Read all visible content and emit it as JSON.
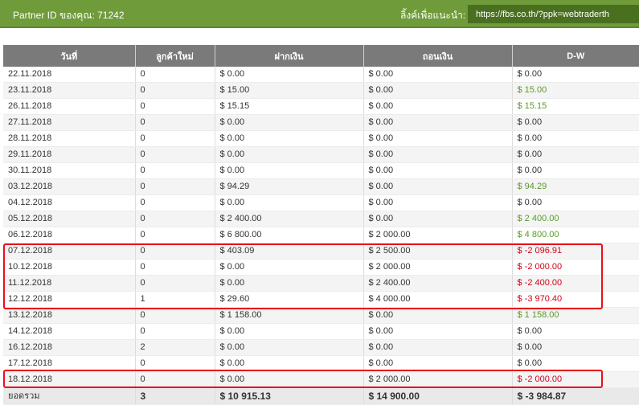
{
  "header": {
    "partner_label": "Partner ID ของคุณ: 71242",
    "referral_label": "ลิ้งค์เพื่อแนะนำ:",
    "referral_link": "https://fbs.co.th/?ppk=webtraderth"
  },
  "table": {
    "columns": [
      "วันที่",
      "ลูกค้าใหม่",
      "ฝากเงิน",
      "ถอนเงิน",
      "D-W"
    ],
    "rows": [
      {
        "date": "22.11.2018",
        "new": "0",
        "deposit": "$ 0.00",
        "withdraw": "$ 0.00",
        "dw": "$ 0.00",
        "dw_type": "zero"
      },
      {
        "date": "23.11.2018",
        "new": "0",
        "deposit": "$ 15.00",
        "withdraw": "$ 0.00",
        "dw": "$ 15.00",
        "dw_type": "pos"
      },
      {
        "date": "26.11.2018",
        "new": "0",
        "deposit": "$ 15.15",
        "withdraw": "$ 0.00",
        "dw": "$ 15.15",
        "dw_type": "pos"
      },
      {
        "date": "27.11.2018",
        "new": "0",
        "deposit": "$ 0.00",
        "withdraw": "$ 0.00",
        "dw": "$ 0.00",
        "dw_type": "zero"
      },
      {
        "date": "28.11.2018",
        "new": "0",
        "deposit": "$ 0.00",
        "withdraw": "$ 0.00",
        "dw": "$ 0.00",
        "dw_type": "zero"
      },
      {
        "date": "29.11.2018",
        "new": "0",
        "deposit": "$ 0.00",
        "withdraw": "$ 0.00",
        "dw": "$ 0.00",
        "dw_type": "zero"
      },
      {
        "date": "30.11.2018",
        "new": "0",
        "deposit": "$ 0.00",
        "withdraw": "$ 0.00",
        "dw": "$ 0.00",
        "dw_type": "zero"
      },
      {
        "date": "03.12.2018",
        "new": "0",
        "deposit": "$ 94.29",
        "withdraw": "$ 0.00",
        "dw": "$ 94.29",
        "dw_type": "pos"
      },
      {
        "date": "04.12.2018",
        "new": "0",
        "deposit": "$ 0.00",
        "withdraw": "$ 0.00",
        "dw": "$ 0.00",
        "dw_type": "zero"
      },
      {
        "date": "05.12.2018",
        "new": "0",
        "deposit": "$ 2 400.00",
        "withdraw": "$ 0.00",
        "dw": "$ 2 400.00",
        "dw_type": "pos"
      },
      {
        "date": "06.12.2018",
        "new": "0",
        "deposit": "$ 6 800.00",
        "withdraw": "$ 2 000.00",
        "dw": "$ 4 800.00",
        "dw_type": "pos"
      },
      {
        "date": "07.12.2018",
        "new": "0",
        "deposit": "$ 403.09",
        "withdraw": "$ 2 500.00",
        "dw": "$ -2 096.91",
        "dw_type": "neg"
      },
      {
        "date": "10.12.2018",
        "new": "0",
        "deposit": "$ 0.00",
        "withdraw": "$ 2 000.00",
        "dw": "$ -2 000.00",
        "dw_type": "neg"
      },
      {
        "date": "11.12.2018",
        "new": "0",
        "deposit": "$ 0.00",
        "withdraw": "$ 2 400.00",
        "dw": "$ -2 400.00",
        "dw_type": "neg"
      },
      {
        "date": "12.12.2018",
        "new": "1",
        "deposit": "$ 29.60",
        "withdraw": "$ 4 000.00",
        "dw": "$ -3 970.40",
        "dw_type": "neg"
      },
      {
        "date": "13.12.2018",
        "new": "0",
        "deposit": "$ 1 158.00",
        "withdraw": "$ 0.00",
        "dw": "$ 1 158.00",
        "dw_type": "pos"
      },
      {
        "date": "14.12.2018",
        "new": "0",
        "deposit": "$ 0.00",
        "withdraw": "$ 0.00",
        "dw": "$ 0.00",
        "dw_type": "zero"
      },
      {
        "date": "16.12.2018",
        "new": "2",
        "deposit": "$ 0.00",
        "withdraw": "$ 0.00",
        "dw": "$ 0.00",
        "dw_type": "zero"
      },
      {
        "date": "17.12.2018",
        "new": "0",
        "deposit": "$ 0.00",
        "withdraw": "$ 0.00",
        "dw": "$ 0.00",
        "dw_type": "zero"
      },
      {
        "date": "18.12.2018",
        "new": "0",
        "deposit": "$ 0.00",
        "withdraw": "$ 2 000.00",
        "dw": "$ -2 000.00",
        "dw_type": "neg"
      }
    ],
    "total": {
      "label": "ยอดรวม",
      "new": "3",
      "deposit": "$ 10 915.13",
      "withdraw": "$ 14 900.00",
      "dw": "$ -3 984.87"
    }
  },
  "colors": {
    "header_bar": "#6f9b3b",
    "link_box": "#49701f",
    "table_header": "#7a7a7a",
    "positive": "#5c9a26",
    "negative": "#d0021b",
    "highlight_border": "#e8101a"
  }
}
